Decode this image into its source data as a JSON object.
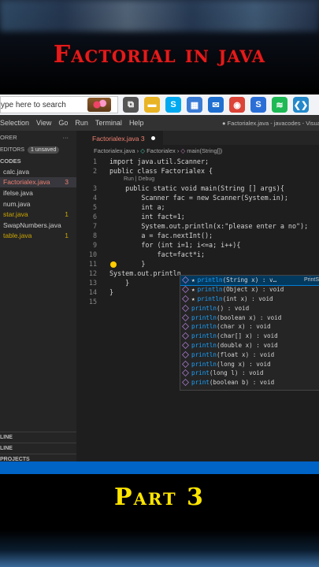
{
  "header": {
    "title": "Factorial in java"
  },
  "taskbar": {
    "search_placeholder": "ype here to search",
    "icons": [
      {
        "name": "task-view-icon",
        "glyph": "⧉",
        "color": "#555"
      },
      {
        "name": "file-explorer-icon",
        "glyph": "▬",
        "color": "#e8b324"
      },
      {
        "name": "skype-icon",
        "glyph": "S",
        "color": "#00a9f0"
      },
      {
        "name": "store-icon",
        "glyph": "▦",
        "color": "#3a7bd5"
      },
      {
        "name": "mail-icon",
        "glyph": "✉",
        "color": "#1f6fd0"
      },
      {
        "name": "chrome-icon",
        "glyph": "◉",
        "color": "#db4437"
      },
      {
        "name": "skype-business-icon",
        "glyph": "S",
        "color": "#2b6fd6"
      },
      {
        "name": "spotify-icon",
        "glyph": "≋",
        "color": "#1db954"
      },
      {
        "name": "vscode-icon",
        "glyph": "❮❯",
        "color": "#2489ca"
      }
    ]
  },
  "menubar": {
    "items": [
      "Selection",
      "View",
      "Go",
      "Run",
      "Terminal",
      "Help"
    ],
    "window_title": "● Factorialex.java - javacodes - Visual"
  },
  "sidebar": {
    "header": "ORER",
    "editors_label": "EDITORS",
    "unsaved_badge": "1 unsaved",
    "folder": "CODES",
    "files": [
      {
        "name": "calc.java",
        "count": "",
        "tone": "plain"
      },
      {
        "name": "Factorialex.java",
        "count": "3",
        "tone": "red",
        "active": true
      },
      {
        "name": "ifelse.java",
        "count": "",
        "tone": "plain"
      },
      {
        "name": "num.java",
        "count": "",
        "tone": "plain"
      },
      {
        "name": "star.java",
        "count": "1",
        "tone": "yellow"
      },
      {
        "name": "SwapNumbers.java",
        "count": "",
        "tone": "plain"
      },
      {
        "name": "table.java",
        "count": "1",
        "tone": "yellow"
      }
    ],
    "footer": [
      "LINE",
      "LINE",
      "PROJECTS"
    ]
  },
  "editor": {
    "tab": {
      "label": "Factorialex.java 3"
    },
    "breadcrumb": {
      "file": "Factorialex.java",
      "class": "Factorialex",
      "method": "main(String[])"
    },
    "codelens": "Run | Debug",
    "lines": [
      "import java.util.Scanner;",
      "public class Factorialex {",
      "    public static void main(String [] args){",
      "        Scanner fac = new Scanner(System.in);",
      "        int a;",
      "        int fact=1;",
      "        System.out.println(x:\"please enter a no\");",
      "        a = fac.nextInt();",
      "        for (int i=1; i<=a; i++){",
      "            fact=fact*i;",
      "        }",
      "System.out.println",
      "    }",
      "}",
      ""
    ]
  },
  "suggestions": [
    {
      "star": true,
      "name": "println",
      "rest": "(String x) : v…",
      "detail": "PrintSt",
      "selected": true
    },
    {
      "star": true,
      "name": "println",
      "rest": "(Object x) : void"
    },
    {
      "star": true,
      "name": "println",
      "rest": "(int x) : void"
    },
    {
      "star": false,
      "name": "println",
      "rest": "() : void"
    },
    {
      "star": false,
      "name": "println",
      "rest": "(boolean x) : void"
    },
    {
      "star": false,
      "name": "println",
      "rest": "(char x) : void"
    },
    {
      "star": false,
      "name": "println",
      "rest": "(char[] x) : void"
    },
    {
      "star": false,
      "name": "println",
      "rest": "(double x) : void"
    },
    {
      "star": false,
      "name": "println",
      "rest": "(float x) : void"
    },
    {
      "star": false,
      "name": "println",
      "rest": "(long x) : void"
    },
    {
      "star": false,
      "name": "print",
      "rest": "(long l) : void"
    },
    {
      "star": false,
      "name": "print",
      "rest": "(boolean b) : void"
    }
  ],
  "footer_title": "Part 3"
}
